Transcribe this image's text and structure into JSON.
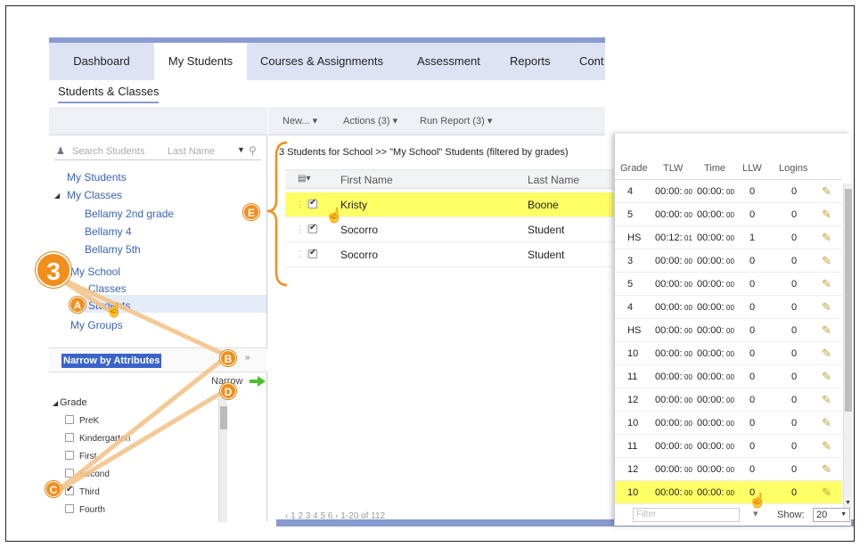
{
  "nav": {
    "items": [
      {
        "label": "Dashboard",
        "active": false
      },
      {
        "label": "My Students",
        "active": true
      },
      {
        "label": "Courses & Assignments",
        "active": false
      },
      {
        "label": "Assessment",
        "active": false
      },
      {
        "label": "Reports",
        "active": false
      },
      {
        "label": "Cont",
        "active": false
      }
    ],
    "sub_title": "Students & Classes"
  },
  "left": {
    "search_placeholder": "Search Students",
    "search_field": "Last Name",
    "tree": {
      "my_students": "My Students",
      "my_classes": "My Classes",
      "classes": [
        "Bellamy 2nd grade",
        "Bellamy 4",
        "Bellamy 5th"
      ],
      "my_school": "My School",
      "school_classes": "Classes",
      "school_students": "Students",
      "my_groups": "My Groups"
    },
    "narrow_title": "Narrow by Attributes",
    "narrow_link": "Narrow",
    "grade_header": "Grade",
    "grades": [
      {
        "label": "PreK",
        "checked": false
      },
      {
        "label": "Kindergarten",
        "checked": false
      },
      {
        "label": "First",
        "checked": false
      },
      {
        "label": "Second",
        "checked": false
      },
      {
        "label": "Third",
        "checked": true
      },
      {
        "label": "Fourth",
        "checked": false
      }
    ]
  },
  "middle": {
    "toolbar": {
      "new": "New...",
      "actions": "Actions (3)",
      "run_report": "Run Report (3)"
    },
    "title": "3 Students for School >> \"My School\" Students (filtered by grades)",
    "columns": {
      "first": "First Name",
      "last": "Last Name"
    },
    "rows": [
      {
        "first": "Kristy",
        "last": "Boone",
        "highlight": true
      },
      {
        "first": "Socorro",
        "last": "Student",
        "highlight": false
      },
      {
        "first": "Socorro",
        "last": "Student",
        "highlight": false
      }
    ],
    "pager": "‹ 1 2 3 4 5 6 ›   1-20 of 112"
  },
  "right": {
    "columns": {
      "grade": "Grade",
      "tlw": "TLW",
      "time": "Time",
      "llw": "LLW",
      "logins": "Logins"
    },
    "rows": [
      {
        "grade": "4",
        "tlw": "00:00:",
        "tlw_s": "00",
        "time": "00:00:",
        "time_s": "00",
        "llw": "0",
        "logins": "0",
        "highlight": false
      },
      {
        "grade": "5",
        "tlw": "00:00:",
        "tlw_s": "00",
        "time": "00:00:",
        "time_s": "00",
        "llw": "0",
        "logins": "0",
        "highlight": false
      },
      {
        "grade": "HS",
        "tlw": "00:12:",
        "tlw_s": "01",
        "time": "00:00:",
        "time_s": "00",
        "llw": "1",
        "logins": "0",
        "highlight": false
      },
      {
        "grade": "3",
        "tlw": "00:00:",
        "tlw_s": "00",
        "time": "00:00:",
        "time_s": "00",
        "llw": "0",
        "logins": "0",
        "highlight": false
      },
      {
        "grade": "5",
        "tlw": "00:00:",
        "tlw_s": "00",
        "time": "00:00:",
        "time_s": "00",
        "llw": "0",
        "logins": "0",
        "highlight": false
      },
      {
        "grade": "4",
        "tlw": "00:00:",
        "tlw_s": "00",
        "time": "00:00:",
        "time_s": "00",
        "llw": "0",
        "logins": "0",
        "highlight": false
      },
      {
        "grade": "HS",
        "tlw": "00:00:",
        "tlw_s": "00",
        "time": "00:00:",
        "time_s": "00",
        "llw": "0",
        "logins": "0",
        "highlight": false
      },
      {
        "grade": "10",
        "tlw": "00:00:",
        "tlw_s": "00",
        "time": "00:00:",
        "time_s": "00",
        "llw": "0",
        "logins": "0",
        "highlight": false
      },
      {
        "grade": "11",
        "tlw": "00:00:",
        "tlw_s": "00",
        "time": "00:00:",
        "time_s": "00",
        "llw": "0",
        "logins": "0",
        "highlight": false
      },
      {
        "grade": "12",
        "tlw": "00:00:",
        "tlw_s": "00",
        "time": "00:00:",
        "time_s": "00",
        "llw": "0",
        "logins": "0",
        "highlight": false
      },
      {
        "grade": "10",
        "tlw": "00:00:",
        "tlw_s": "00",
        "time": "00:00:",
        "time_s": "00",
        "llw": "0",
        "logins": "0",
        "highlight": false
      },
      {
        "grade": "11",
        "tlw": "00:00:",
        "tlw_s": "00",
        "time": "00:00:",
        "time_s": "00",
        "llw": "0",
        "logins": "0",
        "highlight": false
      },
      {
        "grade": "12",
        "tlw": "00:00:",
        "tlw_s": "00",
        "time": "00:00:",
        "time_s": "00",
        "llw": "0",
        "logins": "0",
        "highlight": false
      },
      {
        "grade": "10",
        "tlw": "00:00:",
        "tlw_s": "00",
        "time": "00:00:",
        "time_s": "00",
        "llw": "0",
        "logins": "0",
        "highlight": true
      }
    ],
    "filter_placeholder": "Filter",
    "show_label": "Show:",
    "show_value": "20"
  },
  "annotations": {
    "step": "3",
    "a": "A",
    "b": "B",
    "c": "C",
    "d": "D",
    "e": "E"
  },
  "colors": {
    "accent": "#8a9bd1",
    "highlight": "#ffff66",
    "annotation": "#f28e1a",
    "link": "#3a64b6"
  }
}
